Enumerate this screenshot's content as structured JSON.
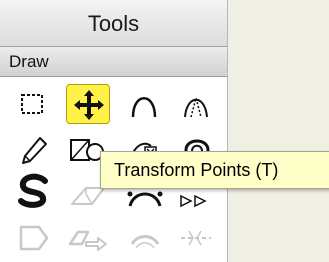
{
  "palette": {
    "title": "Tools",
    "section": "Draw"
  },
  "tools": [
    {
      "icon": "rectangular-selection-icon",
      "enabled": true
    },
    {
      "icon": "transform-points-icon",
      "enabled": true,
      "selected": true
    },
    {
      "icon": "curve-tool-icon",
      "enabled": true
    },
    {
      "icon": "spline-curve-icon",
      "enabled": true
    },
    {
      "icon": "pencil-icon",
      "enabled": true
    },
    {
      "icon": "rectangle-ellipse-shapes-icon",
      "enabled": true
    },
    {
      "icon": "insert-point-icon",
      "enabled": true
    },
    {
      "icon": "arch-shape-icon",
      "enabled": true
    },
    {
      "icon": "freehand-curve-icon",
      "enabled": true
    },
    {
      "icon": "eraser-icon",
      "enabled": false
    },
    {
      "icon": "bezier-curve-icon",
      "enabled": true
    },
    {
      "icon": "arrow-shapes-icon",
      "enabled": true
    },
    {
      "icon": "shape-outline-icon",
      "enabled": false
    },
    {
      "icon": "shape-arrow-icon",
      "enabled": false
    },
    {
      "icon": "curve-path-icon",
      "enabled": false
    },
    {
      "icon": "dashed-line-icon",
      "enabled": false
    }
  ],
  "tooltip": {
    "text": "Transform Points (T)"
  },
  "colors": {
    "selected_background": "#fff14a",
    "tooltip_background": "#fefec8",
    "disabled_icon": "#c8c8c8"
  }
}
